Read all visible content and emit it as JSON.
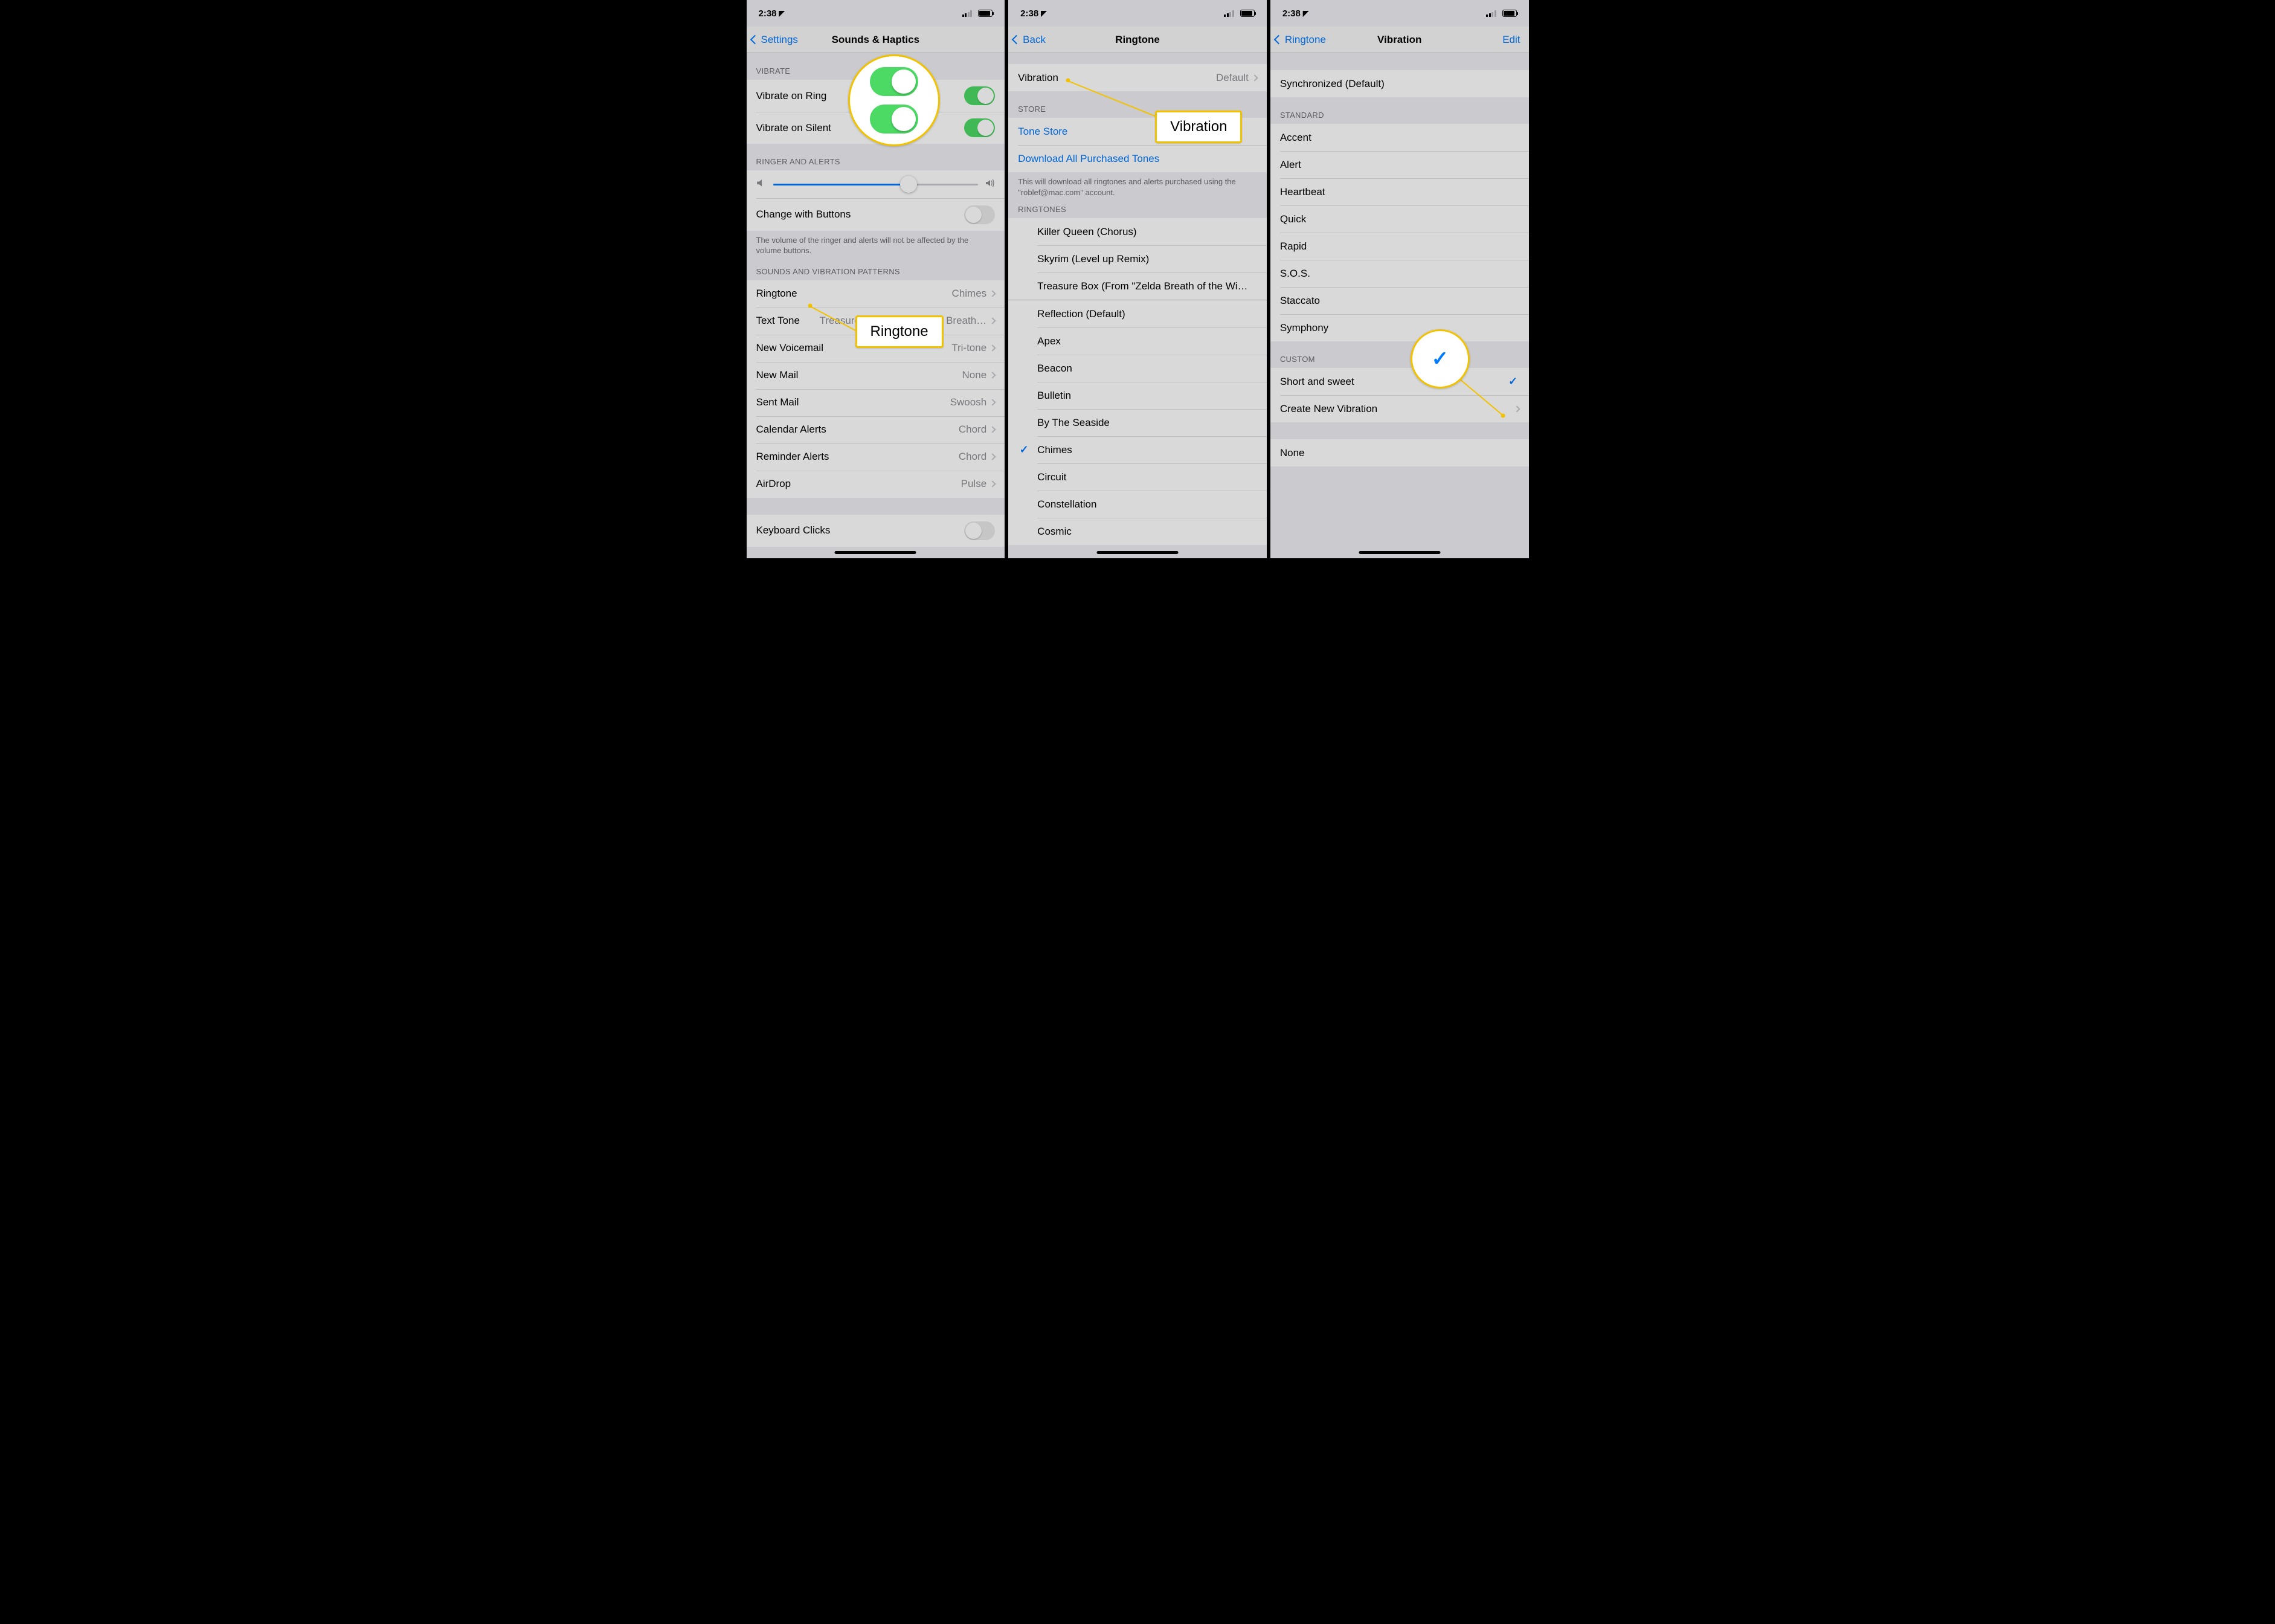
{
  "status": {
    "time": "2:38",
    "loc_glyph": "➤"
  },
  "panel1": {
    "nav": {
      "back": "Settings",
      "title": "Sounds & Haptics"
    },
    "headers": {
      "vibrate": "VIBRATE",
      "ringer": "RINGER AND ALERTS",
      "patterns": "SOUNDS AND VIBRATION PATTERNS"
    },
    "vibrate_ring": "Vibrate on Ring",
    "vibrate_silent": "Vibrate on Silent",
    "change_buttons": "Change with Buttons",
    "footer_volume": "The volume of the ringer and alerts will not be affected by the volume buttons.",
    "rows": [
      {
        "label": "Ringtone",
        "value": "Chimes"
      },
      {
        "label": "Text Tone",
        "value": "Treasure Box (From \"Zelda Breath…"
      },
      {
        "label": "New Voicemail",
        "value": "Tri-tone"
      },
      {
        "label": "New Mail",
        "value": "None"
      },
      {
        "label": "Sent Mail",
        "value": "Swoosh"
      },
      {
        "label": "Calendar Alerts",
        "value": "Chord"
      },
      {
        "label": "Reminder Alerts",
        "value": "Chord"
      },
      {
        "label": "AirDrop",
        "value": "Pulse"
      }
    ],
    "keyboard_clicks": "Keyboard Clicks",
    "callout_label": "Ringtone"
  },
  "panel2": {
    "nav": {
      "back": "Back",
      "title": "Ringtone"
    },
    "vibration_label": "Vibration",
    "vibration_value": "Default",
    "headers": {
      "store": "STORE",
      "ringtones": "RINGTONES"
    },
    "tone_store": "Tone Store",
    "download_all": "Download All Purchased Tones",
    "footer_store": "This will download all ringtones and alerts purchased using the \"roblef@mac.com\" account.",
    "purchased": [
      "Killer Queen (Chorus)",
      "Skyrim (Level up Remix)",
      "Treasure Box (From \"Zelda Breath of the Wi…"
    ],
    "builtin": [
      "Reflection (Default)",
      "Apex",
      "Beacon",
      "Bulletin",
      "By The Seaside",
      "Chimes",
      "Circuit",
      "Constellation",
      "Cosmic"
    ],
    "selected": "Chimes",
    "callout_label": "Vibration"
  },
  "panel3": {
    "nav": {
      "back": "Ringtone",
      "title": "Vibration",
      "edit": "Edit"
    },
    "sync": "Synchronized (Default)",
    "headers": {
      "standard": "STANDARD",
      "custom": "CUSTOM"
    },
    "standard": [
      "Accent",
      "Alert",
      "Heartbeat",
      "Quick",
      "Rapid",
      "S.O.S.",
      "Staccato",
      "Symphony"
    ],
    "custom_selected": "Short and sweet",
    "create_new": "Create New Vibration",
    "none": "None"
  }
}
